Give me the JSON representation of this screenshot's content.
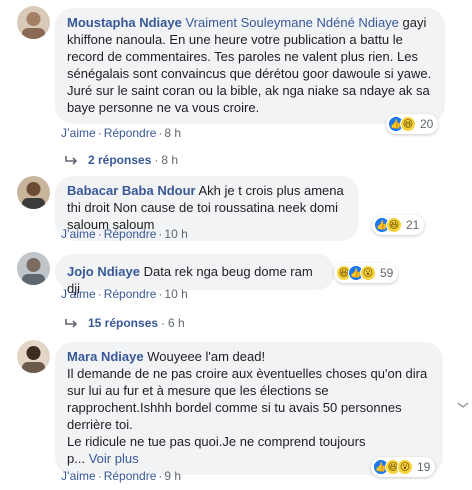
{
  "comments": [
    {
      "author": "Moustapha Ndiaye",
      "mention": "Vraiment Souleymane Ndéné Ndiaye",
      "text": "gayi khiffone nanoula. En une heure votre publication a battu le record de commentaires. Tes paroles ne valent plus rien. Les sénégalais sont convaincus que dérétou goor dawoule si yawe. Juré sur le saint coran ou la bible, ak nga niake sa ndaye ak sa baye personne ne va vous croire.",
      "like_label": "J’aime",
      "reply_label": "Répondre",
      "time": "8 h",
      "reactions": [
        "like",
        "haha"
      ],
      "reaction_count": "20",
      "replies_label": "2 réponses",
      "replies_time": "8 h"
    },
    {
      "author": "Babacar Baba Ndour",
      "text": "Akh je t crois plus amena thi droit Non cause de toi roussatina neek domi saloum saloum",
      "like_label": "J’aime",
      "reply_label": "Répondre",
      "time": "10 h",
      "reactions": [
        "like",
        "haha"
      ],
      "reaction_count": "21"
    },
    {
      "author": "Jojo Ndiaye",
      "text": "Data rek nga beug dome ram dji",
      "like_label": "J’aime",
      "reply_label": "Répondre",
      "time": "10 h",
      "reactions": [
        "haha",
        "like",
        "wow"
      ],
      "reaction_count": "59",
      "replies_label": "15 réponses",
      "replies_time": "6 h"
    },
    {
      "author": "Mara Ndiaye",
      "text_first": "Wouyeee l'am dead!",
      "text": "Il demande de ne pas croire aux èventuelles choses qu'on dira sur lui au fur et à mesure que les élections se rapprochent.Ishhh bordel comme si tu avais 50 personnes derrière toi.",
      "text2": "Le ridicule ne tue pas quoi.Je ne comprend toujours",
      "text3": "p...",
      "see_more": "Voir plus",
      "like_label": "J’aime",
      "reply_label": "Répondre",
      "time": "9 h",
      "reactions": [
        "like",
        "haha",
        "wow"
      ],
      "reaction_count": "19"
    }
  ],
  "colors": {
    "link": "#385898",
    "bubble": "#f2f3f5",
    "meta": "#606770",
    "like": "#1877f2",
    "emoji": "#f7d33b"
  },
  "icons": [
    "like-icon",
    "haha-icon",
    "wow-icon",
    "reply-arrow-icon",
    "avatar"
  ]
}
